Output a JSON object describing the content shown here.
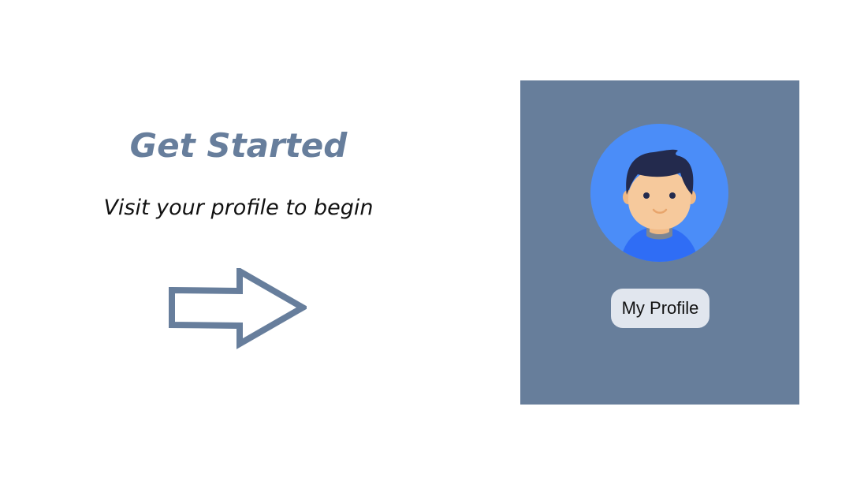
{
  "left": {
    "title": "Get Started",
    "subtitle": "Visit your profile to begin",
    "arrow_icon": "right-arrow-outline-icon"
  },
  "card": {
    "avatar_icon": "user-avatar-icon",
    "button_label": "My Profile"
  },
  "colors": {
    "accent": "#677e9b",
    "avatar_bg": "#4b8df8",
    "button_bg": "#e1e6ee",
    "hair": "#232a4d",
    "skin": "#f6c99c",
    "shirt": "#2f6df5"
  }
}
